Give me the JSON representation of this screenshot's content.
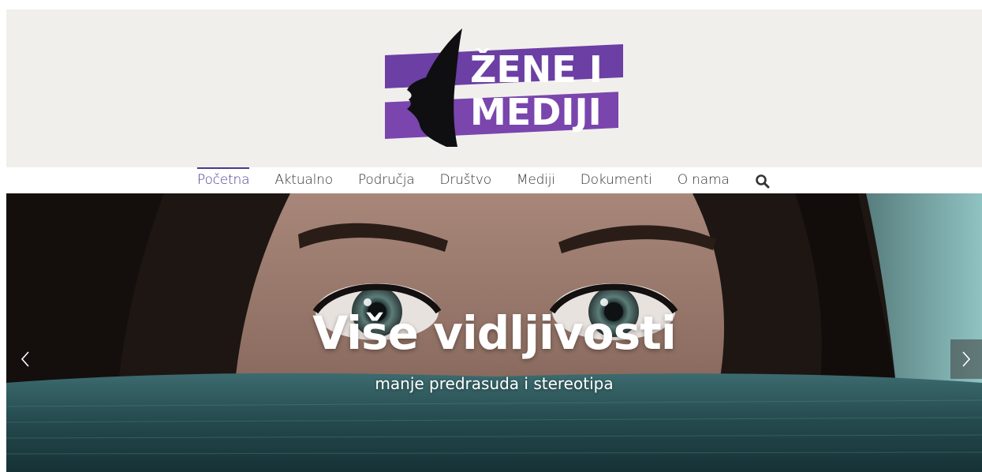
{
  "logo": {
    "line1": "ŽENE I",
    "line2": "MEDIJI",
    "purple": "#6a3fa0",
    "purple_light": "#8a4fb5"
  },
  "nav": {
    "items": [
      {
        "label": "Početna",
        "active": true
      },
      {
        "label": "Aktualno",
        "active": false
      },
      {
        "label": "Područja",
        "active": false
      },
      {
        "label": "Društvo",
        "active": false
      },
      {
        "label": "Mediji",
        "active": false
      },
      {
        "label": "Dokumenti",
        "active": false
      },
      {
        "label": "O nama",
        "active": false
      }
    ],
    "search_icon": "search-icon",
    "accent": "#4a3b8f"
  },
  "hero": {
    "title": "Više vidljivosti",
    "subtitle": "manje predrasuda i stereotipa",
    "prev_icon": "chevron-left-icon",
    "next_icon": "chevron-right-icon"
  }
}
